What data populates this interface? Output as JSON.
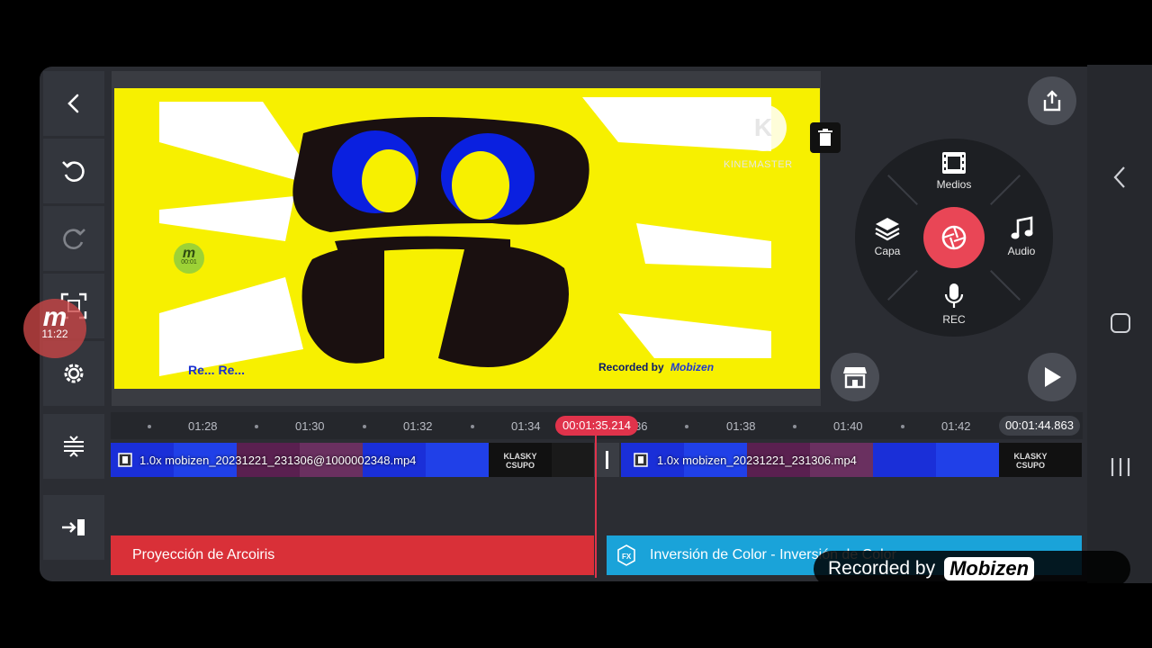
{
  "toolbar": {
    "back": "back-icon",
    "undo": "undo-icon",
    "redo": "redo-icon",
    "fit": "fit-screen-icon",
    "settings": "gear-icon",
    "timeline_adjust": "timeline-adjust-icon",
    "exit": "exit-icon"
  },
  "mobizen_bubble": {
    "time": "11:22"
  },
  "preview": {
    "watermark_text": "KINEMASTER",
    "recorded_by": "Recorded by",
    "mobizen_logo": "Mobizen",
    "mini_badge_time": "00:01"
  },
  "wheel": {
    "media_label": "Medios",
    "layer_label": "Capa",
    "audio_label": "Audio",
    "rec_label": "REC"
  },
  "timeline": {
    "ticks": [
      "01:28",
      "01:30",
      "01:32",
      "01:34",
      "01:36",
      "01:38",
      "01:40",
      "01:42"
    ],
    "current_time": "00:01:35.214",
    "end_time": "00:01:44.863",
    "clips": [
      {
        "label": "1.0x mobizen_20231221_231306@1000002348.mp4"
      },
      {
        "label": "1.0x mobizen_20231221_231306.mp4"
      }
    ],
    "thumb_text": "KLASKY CSUPO",
    "effects": [
      {
        "label": "Proyección de Arcoiris",
        "color": "#d93038"
      },
      {
        "label": "Inversión de Color - Inversión de Color",
        "color": "#1aa3d9"
      }
    ]
  },
  "recorded_overlay": {
    "text": "Recorded by",
    "logo": "Mobizen"
  }
}
